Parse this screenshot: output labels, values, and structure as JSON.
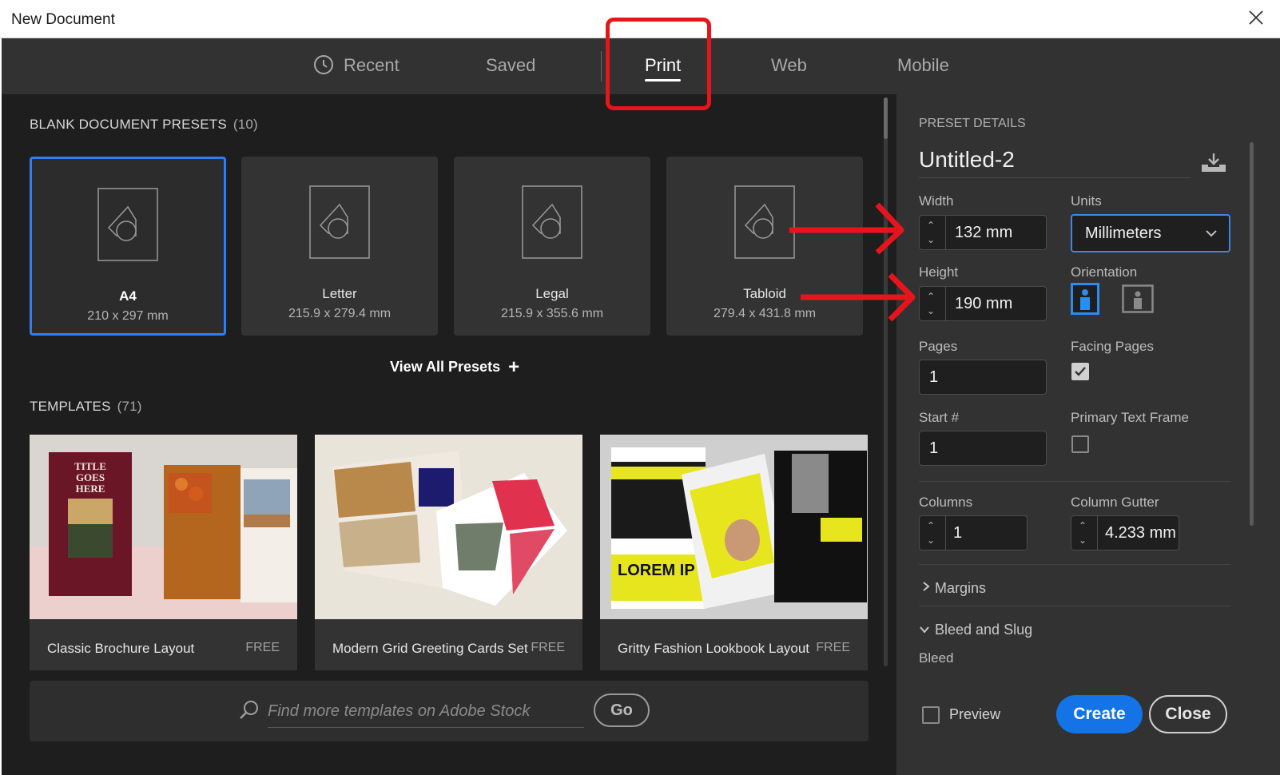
{
  "window": {
    "title": "New Document"
  },
  "tabs": [
    {
      "label": "Recent",
      "icon": "clock-icon",
      "active": false
    },
    {
      "label": "Saved",
      "active": false
    },
    {
      "label": "Print",
      "active": true
    },
    {
      "label": "Web",
      "active": false
    },
    {
      "label": "Mobile",
      "active": false
    }
  ],
  "presets_section": {
    "title": "BLANK DOCUMENT PRESETS",
    "count": "(10)"
  },
  "presets": [
    {
      "name": "A4",
      "size": "210 x 297 mm",
      "selected": true
    },
    {
      "name": "Letter",
      "size": "215.9 x 279.4 mm",
      "selected": false
    },
    {
      "name": "Legal",
      "size": "215.9 x 355.6 mm",
      "selected": false
    },
    {
      "name": "Tabloid",
      "size": "279.4 x 431.8 mm",
      "selected": false
    }
  ],
  "view_all": {
    "label": "View All Presets",
    "icon": "plus-icon"
  },
  "templates_section": {
    "title": "TEMPLATES",
    "count": "(71)"
  },
  "templates": [
    {
      "name": "Classic Brochure Layout",
      "price": "FREE",
      "thumb_text": "TITLE GOES HERE"
    },
    {
      "name": "Modern Grid Greeting Cards Set",
      "price": "FREE"
    },
    {
      "name": "Gritty Fashion Lookbook Layout",
      "price": "FREE",
      "thumb_text": "LOREM IP"
    }
  ],
  "search": {
    "placeholder": "Find more templates on Adobe Stock",
    "go_label": "Go"
  },
  "details": {
    "header": "PRESET DETAILS",
    "doc_name": "Untitled-2",
    "width_label": "Width",
    "width_value": "132 mm",
    "units_label": "Units",
    "units_value": "Millimeters",
    "height_label": "Height",
    "height_value": "190 mm",
    "orientation_label": "Orientation",
    "orientation_value": "portrait",
    "pages_label": "Pages",
    "pages_value": "1",
    "facing_label": "Facing Pages",
    "facing_checked": true,
    "start_label": "Start #",
    "start_value": "1",
    "primary_label": "Primary Text Frame",
    "primary_checked": false,
    "columns_label": "Columns",
    "columns_value": "1",
    "gutter_label": "Column Gutter",
    "gutter_value": "4.233 mm",
    "margins_label": "Margins",
    "bleed_slug_label": "Bleed and Slug",
    "bleed_label": "Bleed"
  },
  "footer": {
    "preview_label": "Preview",
    "create_label": "Create",
    "close_label": "Close"
  },
  "colors": {
    "accent": "#1473e6",
    "selection": "#2d7ff9",
    "annotation": "#e8141c",
    "panel": "#323232",
    "background": "#1e1e1e"
  }
}
